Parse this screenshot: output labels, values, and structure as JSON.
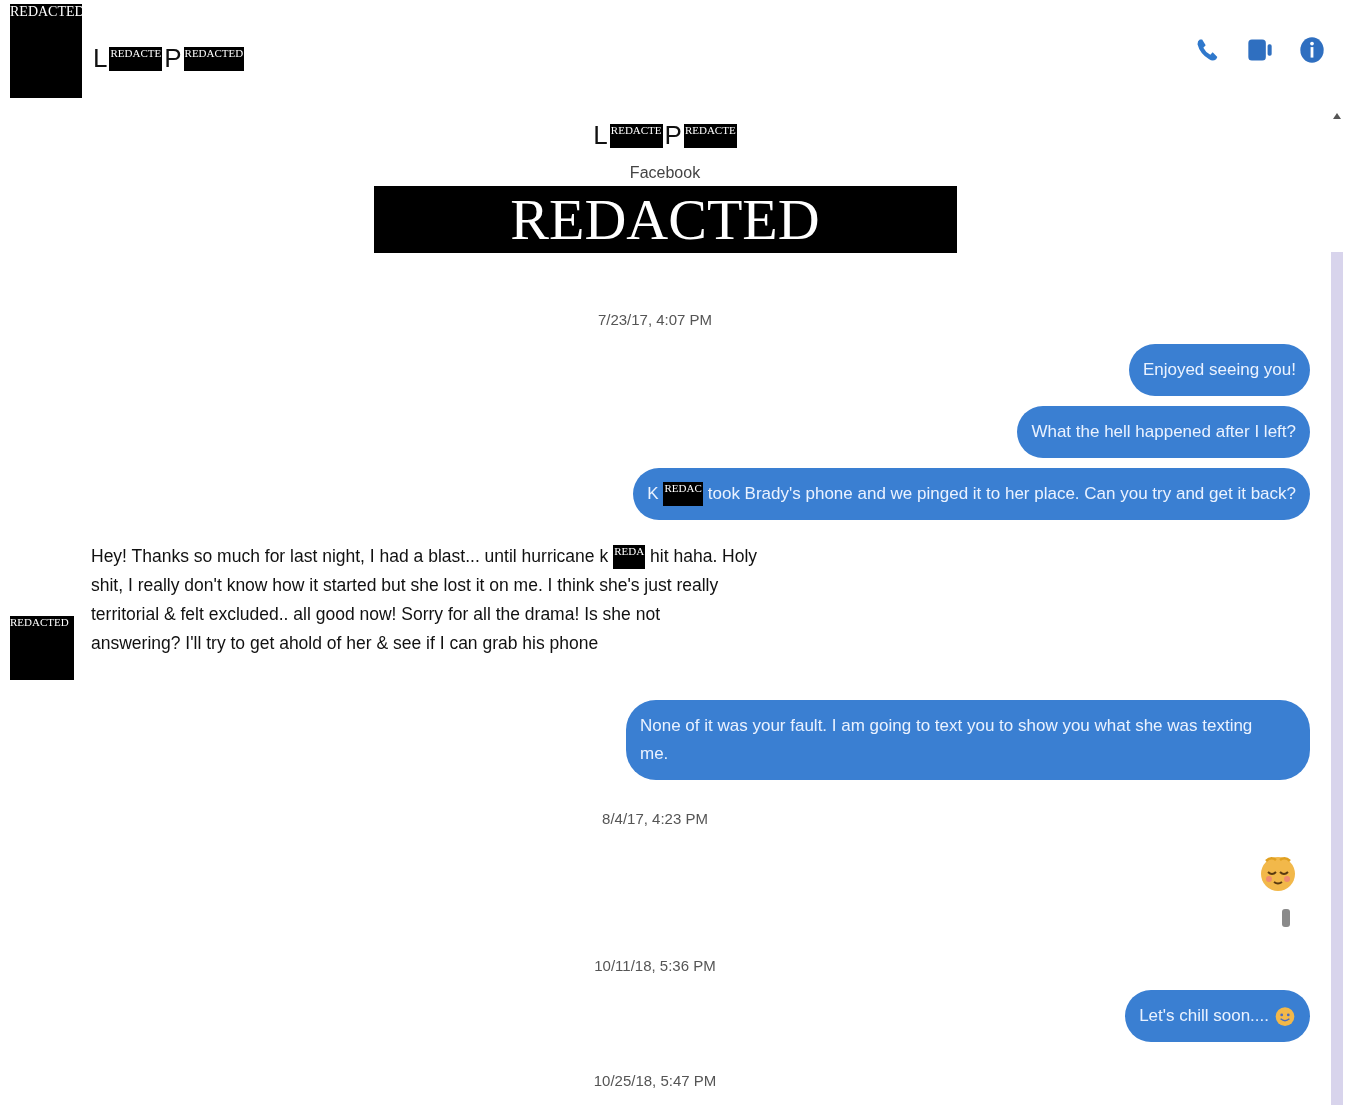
{
  "header": {
    "avatar": "REDACTED",
    "name": [
      {
        "kind": "text",
        "text": "L"
      },
      {
        "kind": "redacted",
        "text": "REDACTE"
      },
      {
        "kind": "text",
        "text": "P"
      },
      {
        "kind": "redacted",
        "text": "REDACTED"
      }
    ]
  },
  "profile": {
    "name": [
      {
        "kind": "text",
        "text": "L"
      },
      {
        "kind": "redacted",
        "text": "REDACTE"
      },
      {
        "kind": "text",
        "text": "P"
      },
      {
        "kind": "redacted",
        "text": "REDACTE"
      }
    ],
    "platform": "Facebook",
    "banner": "REDACTED"
  },
  "thread": [
    {
      "kind": "timestamp",
      "text": "7/23/17, 4:07 PM"
    },
    {
      "kind": "outgoing",
      "parts": [
        {
          "kind": "text",
          "text": "Enjoyed seeing you!"
        }
      ]
    },
    {
      "kind": "outgoing",
      "parts": [
        {
          "kind": "text",
          "text": "What the hell happened after I left?"
        }
      ]
    },
    {
      "kind": "outgoing",
      "parts": [
        {
          "kind": "text",
          "text": "K"
        },
        {
          "kind": "redacted",
          "text": "REDAC"
        },
        {
          "kind": "text",
          "text": "took Brady's phone and we pinged it to her place. Can you try and get it back?"
        }
      ]
    },
    {
      "kind": "incoming",
      "avatar": "REDACTED",
      "lines": [
        [
          {
            "kind": "text",
            "text": "Hey! Thanks so much for last night, I had a blast... until hurricane k"
          },
          {
            "kind": "redacted",
            "text": "REDA"
          },
          {
            "kind": "text",
            "text": "hit haha. Holy"
          }
        ],
        [
          {
            "kind": "text",
            "text": "shit, I really don't know how it started but she lost it on me. I think she's just really"
          }
        ],
        [
          {
            "kind": "text",
            "text": "territorial & felt excluded.. all good now! Sorry for all the drama! Is she not"
          }
        ],
        [
          {
            "kind": "text",
            "text": "answering? I'll try to get ahold of her & see if I can grab his phone"
          }
        ]
      ]
    },
    {
      "kind": "outgoing",
      "parts": [
        {
          "kind": "text",
          "text": "None of it was your fault. I am going to text you to show you what she was texting me."
        }
      ]
    },
    {
      "kind": "timestamp",
      "text": "8/4/17, 4:23 PM"
    },
    {
      "kind": "emoji"
    },
    {
      "kind": "seen"
    },
    {
      "kind": "timestamp",
      "text": "10/11/18, 5:36 PM"
    },
    {
      "kind": "outgoing",
      "parts": [
        {
          "kind": "text",
          "text": "Let's chill soon...."
        },
        {
          "kind": "emoji"
        }
      ]
    },
    {
      "kind": "timestamp",
      "text": "10/25/18, 5:47 PM"
    }
  ]
}
